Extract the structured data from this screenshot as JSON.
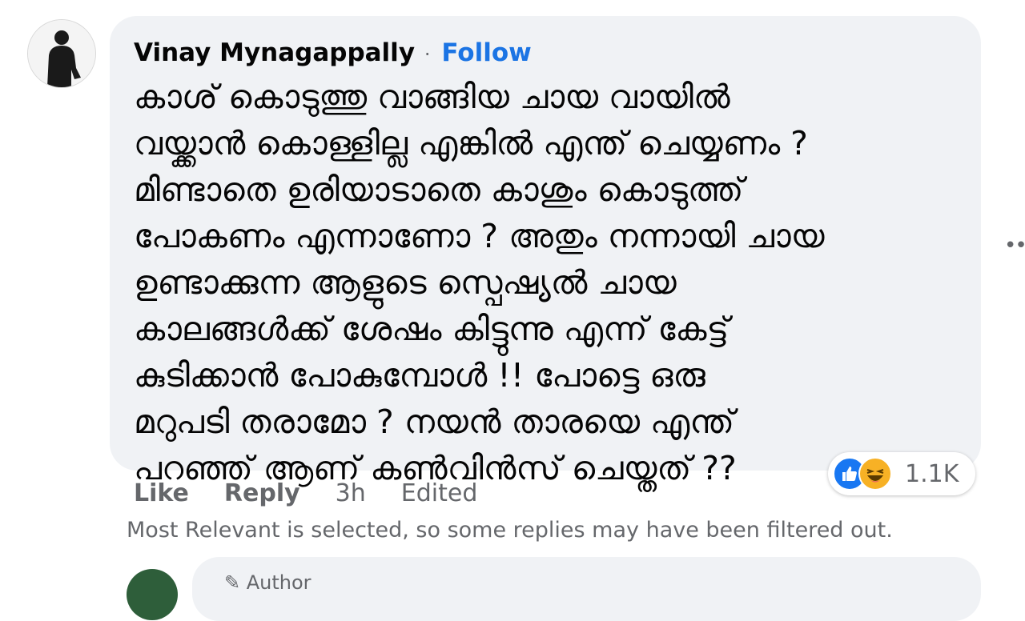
{
  "comment": {
    "author": "Vinay Mynagappally",
    "separator": "·",
    "follow_label": "Follow",
    "text_lines": [
      "കാശ് കൊടുത്തു വാങ്ങിയ ചായ വായിൽ",
      "വയ്ക്കാൻ കൊള്ളില്ല എങ്കിൽ എന്ത് ചെയ്യണം ?",
      "മിണ്ടാതെ ഉരിയാടാതെ കാശും കൊടുത്ത്",
      "പോകണം എന്നാണോ ? അതും നന്നായി ചായ",
      "ഉണ്ടാക്കുന്ന ആളുടെ സ്പെഷ്യൽ ചായ",
      "കാലങ്ങൾക്ക് ശേഷം കിട്ടുന്നു എന്ന് കേട്ട്",
      "കുടിക്കാൻ പോകുമ്പോൾ !! പോട്ടെ ഒരു",
      "മറുപടി തരാമോ ? നയൻ താരയെ എന്ത്",
      "പറഞ്ഞ് ആണ് കൺവിൻസ് ചെയ്തത് ??"
    ],
    "reactions": {
      "icons": [
        "like-icon",
        "haha-icon"
      ],
      "count": "1.1K",
      "colors": {
        "like": "#1877f2",
        "haha": "#f7b125"
      }
    },
    "actions": {
      "like_label": "Like",
      "reply_label": "Reply",
      "time": "3h",
      "edited_label": "Edited"
    }
  },
  "filter_note": "Most Relevant is selected, so some replies may have been filtered out.",
  "next_reply": {
    "badge_label": "Author"
  },
  "more_options_icon": "more-horizontal-icon",
  "colors": {
    "bubble_bg": "#f0f2f5",
    "link_blue": "#1b74e4",
    "secondary_text": "#65676b"
  }
}
